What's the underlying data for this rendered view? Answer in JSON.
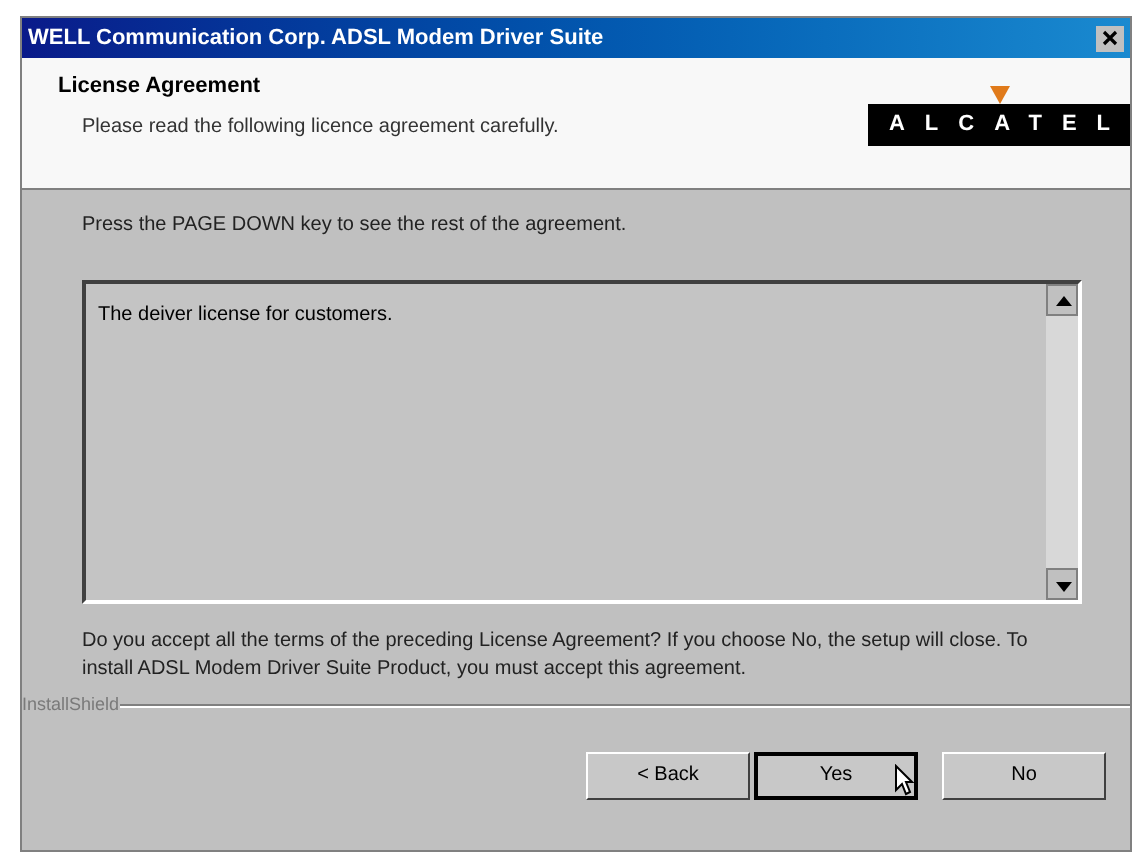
{
  "window": {
    "title": "WELL Communication Corp. ADSL Modem Driver Suite"
  },
  "header": {
    "title": "License Agreement",
    "subtitle": "Please read the following licence agreement carefully.",
    "logo": "ALCATEL"
  },
  "instruction": "Press the PAGE DOWN key to see the rest of the agreement.",
  "license_text": "The deiver license for customers.",
  "question": "Do you accept all the terms of the preceding License Agreement?  If you choose No,  the setup will close.  To install ADSL Modem Driver Suite Product, you must accept this agreement.",
  "footer_label": "InstallShield",
  "buttons": [
    {
      "label": "< Back",
      "focused": false
    },
    {
      "label": "Yes",
      "focused": true
    },
    {
      "label": "No",
      "focused": false
    }
  ]
}
